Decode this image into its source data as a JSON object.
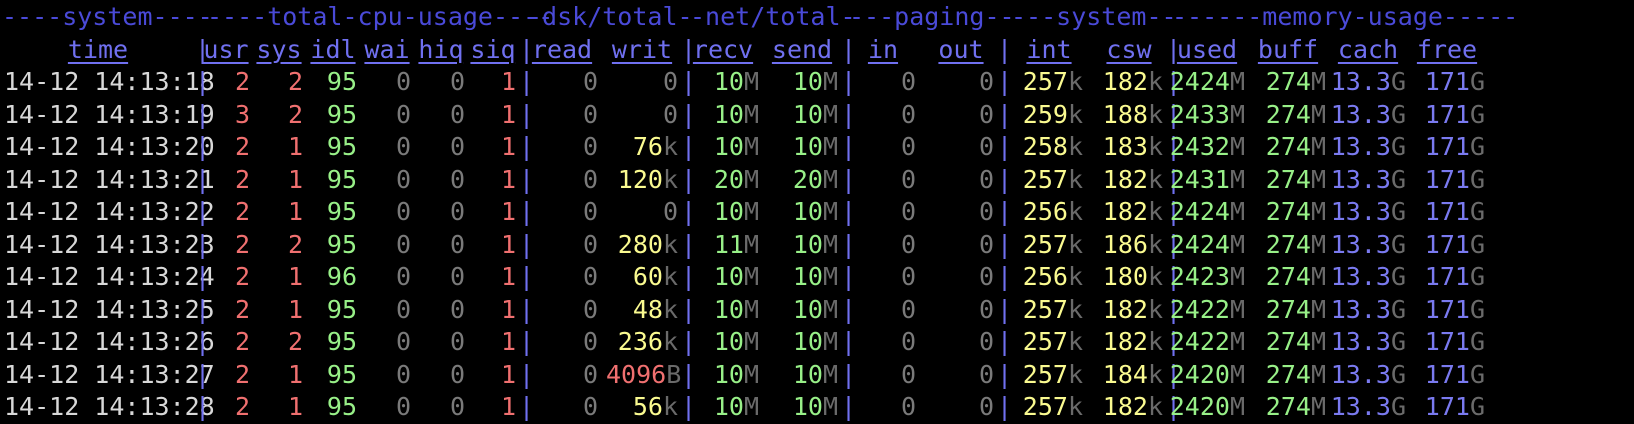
{
  "colors": {
    "background": "#000000",
    "header": "#7070f0",
    "group_header": "#4a4ad8",
    "time": "#d8d8d8",
    "red": "#f07070",
    "green": "#98f088",
    "yellow": "#fafa90",
    "gray": "#7a7a7a",
    "blue": "#7a7af0"
  },
  "groups": [
    "----system----",
    "----total-cpu-usage----",
    "-dsk/total-",
    "-net/total-",
    "---paging--",
    "---system--",
    "------memory-usage-----"
  ],
  "columns": [
    "time",
    "usr",
    "sys",
    "idl",
    "wai",
    "hiq",
    "siq",
    "read",
    "writ",
    "recv",
    "send",
    "in",
    "out",
    "int",
    "csw",
    "used",
    "buff",
    "cach",
    "free"
  ],
  "separator": "|",
  "rows": [
    [
      "14-12 14:13:18",
      "2",
      "2",
      "95",
      "0",
      "0",
      "1",
      "0",
      "0",
      "10M",
      "10M",
      "0",
      "0",
      "257k",
      "182k",
      "2424M",
      "274M",
      "13.3G",
      "171G"
    ],
    [
      "14-12 14:13:19",
      "3",
      "2",
      "95",
      "0",
      "0",
      "1",
      "0",
      "0",
      "10M",
      "10M",
      "0",
      "0",
      "259k",
      "188k",
      "2433M",
      "274M",
      "13.3G",
      "171G"
    ],
    [
      "14-12 14:13:20",
      "2",
      "1",
      "95",
      "0",
      "0",
      "1",
      "0",
      "76k",
      "10M",
      "10M",
      "0",
      "0",
      "258k",
      "183k",
      "2432M",
      "274M",
      "13.3G",
      "171G"
    ],
    [
      "14-12 14:13:21",
      "2",
      "1",
      "95",
      "0",
      "0",
      "1",
      "0",
      "120k",
      "20M",
      "20M",
      "0",
      "0",
      "257k",
      "182k",
      "2431M",
      "274M",
      "13.3G",
      "171G"
    ],
    [
      "14-12 14:13:22",
      "2",
      "1",
      "95",
      "0",
      "0",
      "1",
      "0",
      "0",
      "10M",
      "10M",
      "0",
      "0",
      "256k",
      "182k",
      "2424M",
      "274M",
      "13.3G",
      "171G"
    ],
    [
      "14-12 14:13:23",
      "2",
      "2",
      "95",
      "0",
      "0",
      "1",
      "0",
      "280k",
      "11M",
      "10M",
      "0",
      "0",
      "257k",
      "186k",
      "2424M",
      "274M",
      "13.3G",
      "171G"
    ],
    [
      "14-12 14:13:24",
      "2",
      "1",
      "96",
      "0",
      "0",
      "1",
      "0",
      "60k",
      "10M",
      "10M",
      "0",
      "0",
      "256k",
      "180k",
      "2423M",
      "274M",
      "13.3G",
      "171G"
    ],
    [
      "14-12 14:13:25",
      "2",
      "1",
      "95",
      "0",
      "0",
      "1",
      "0",
      "48k",
      "10M",
      "10M",
      "0",
      "0",
      "257k",
      "182k",
      "2422M",
      "274M",
      "13.3G",
      "171G"
    ],
    [
      "14-12 14:13:26",
      "2",
      "2",
      "95",
      "0",
      "0",
      "1",
      "0",
      "236k",
      "10M",
      "10M",
      "0",
      "0",
      "257k",
      "182k",
      "2422M",
      "274M",
      "13.3G",
      "171G"
    ],
    [
      "14-12 14:13:27",
      "2",
      "1",
      "95",
      "0",
      "0",
      "1",
      "0",
      "4096B",
      "10M",
      "10M",
      "0",
      "0",
      "257k",
      "184k",
      "2420M",
      "274M",
      "13.3G",
      "171G"
    ],
    [
      "14-12 14:13:28",
      "2",
      "1",
      "95",
      "0",
      "0",
      "1",
      "0",
      "56k",
      "10M",
      "10M",
      "0",
      "0",
      "257k",
      "182k",
      "2420M",
      "274M",
      "13.3G",
      "171G"
    ]
  ]
}
